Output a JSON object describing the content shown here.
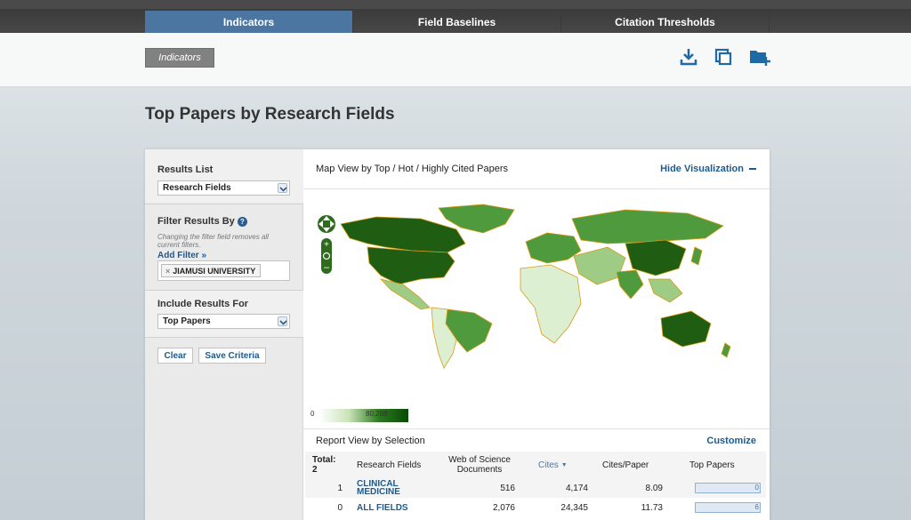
{
  "nav": {
    "tabs": [
      {
        "label": "Indicators",
        "active": true
      },
      {
        "label": "Field Baselines",
        "active": false
      },
      {
        "label": "Citation Thresholds",
        "active": false
      }
    ]
  },
  "subbar": {
    "breadcrumb": "Indicators",
    "icons": [
      "download-icon",
      "print-icon",
      "add-folder-icon"
    ]
  },
  "page": {
    "title": "Top Papers by Research Fields"
  },
  "sidebar": {
    "results_list_label": "Results List",
    "results_list_value": "Research Fields",
    "filter_label": "Filter Results By",
    "filter_hint": "Changing the filter field removes all current filters.",
    "add_filter": "Add Filter »",
    "filter_chip": "JIAMUSI UNIVERSITY",
    "include_label": "Include Results For",
    "include_value": "Top Papers",
    "clear": "Clear",
    "save": "Save Criteria"
  },
  "map": {
    "heading": "Map View by Top / Hot / Highly Cited Papers",
    "hide": "Hide Visualization",
    "legend_min": "0",
    "legend_max": "80,288",
    "colors": {
      "dark": "#1f5e12",
      "mid": "#4f9a3c",
      "light": "#9fcc84",
      "pale": "#dcefd0",
      "border": "#d99a16",
      "ocean": "#ffffff"
    }
  },
  "report": {
    "heading": "Report View by Selection",
    "customize": "Customize",
    "headers": {
      "total": "Total: 2",
      "field": "Research Fields",
      "docs": "Web of Science Documents",
      "cites": "Cites",
      "cites_paper": "Cites/Paper",
      "top_papers": "Top Papers"
    },
    "rows": [
      {
        "rank": "1",
        "field": "CLINICAL MEDICINE",
        "docs": "516",
        "cites": "4,174",
        "cites_paper": "8.09",
        "top_papers": "0"
      },
      {
        "rank": "0",
        "field": "ALL FIELDS",
        "docs": "2,076",
        "cites": "24,345",
        "cites_paper": "11.73",
        "top_papers": "6"
      }
    ]
  }
}
